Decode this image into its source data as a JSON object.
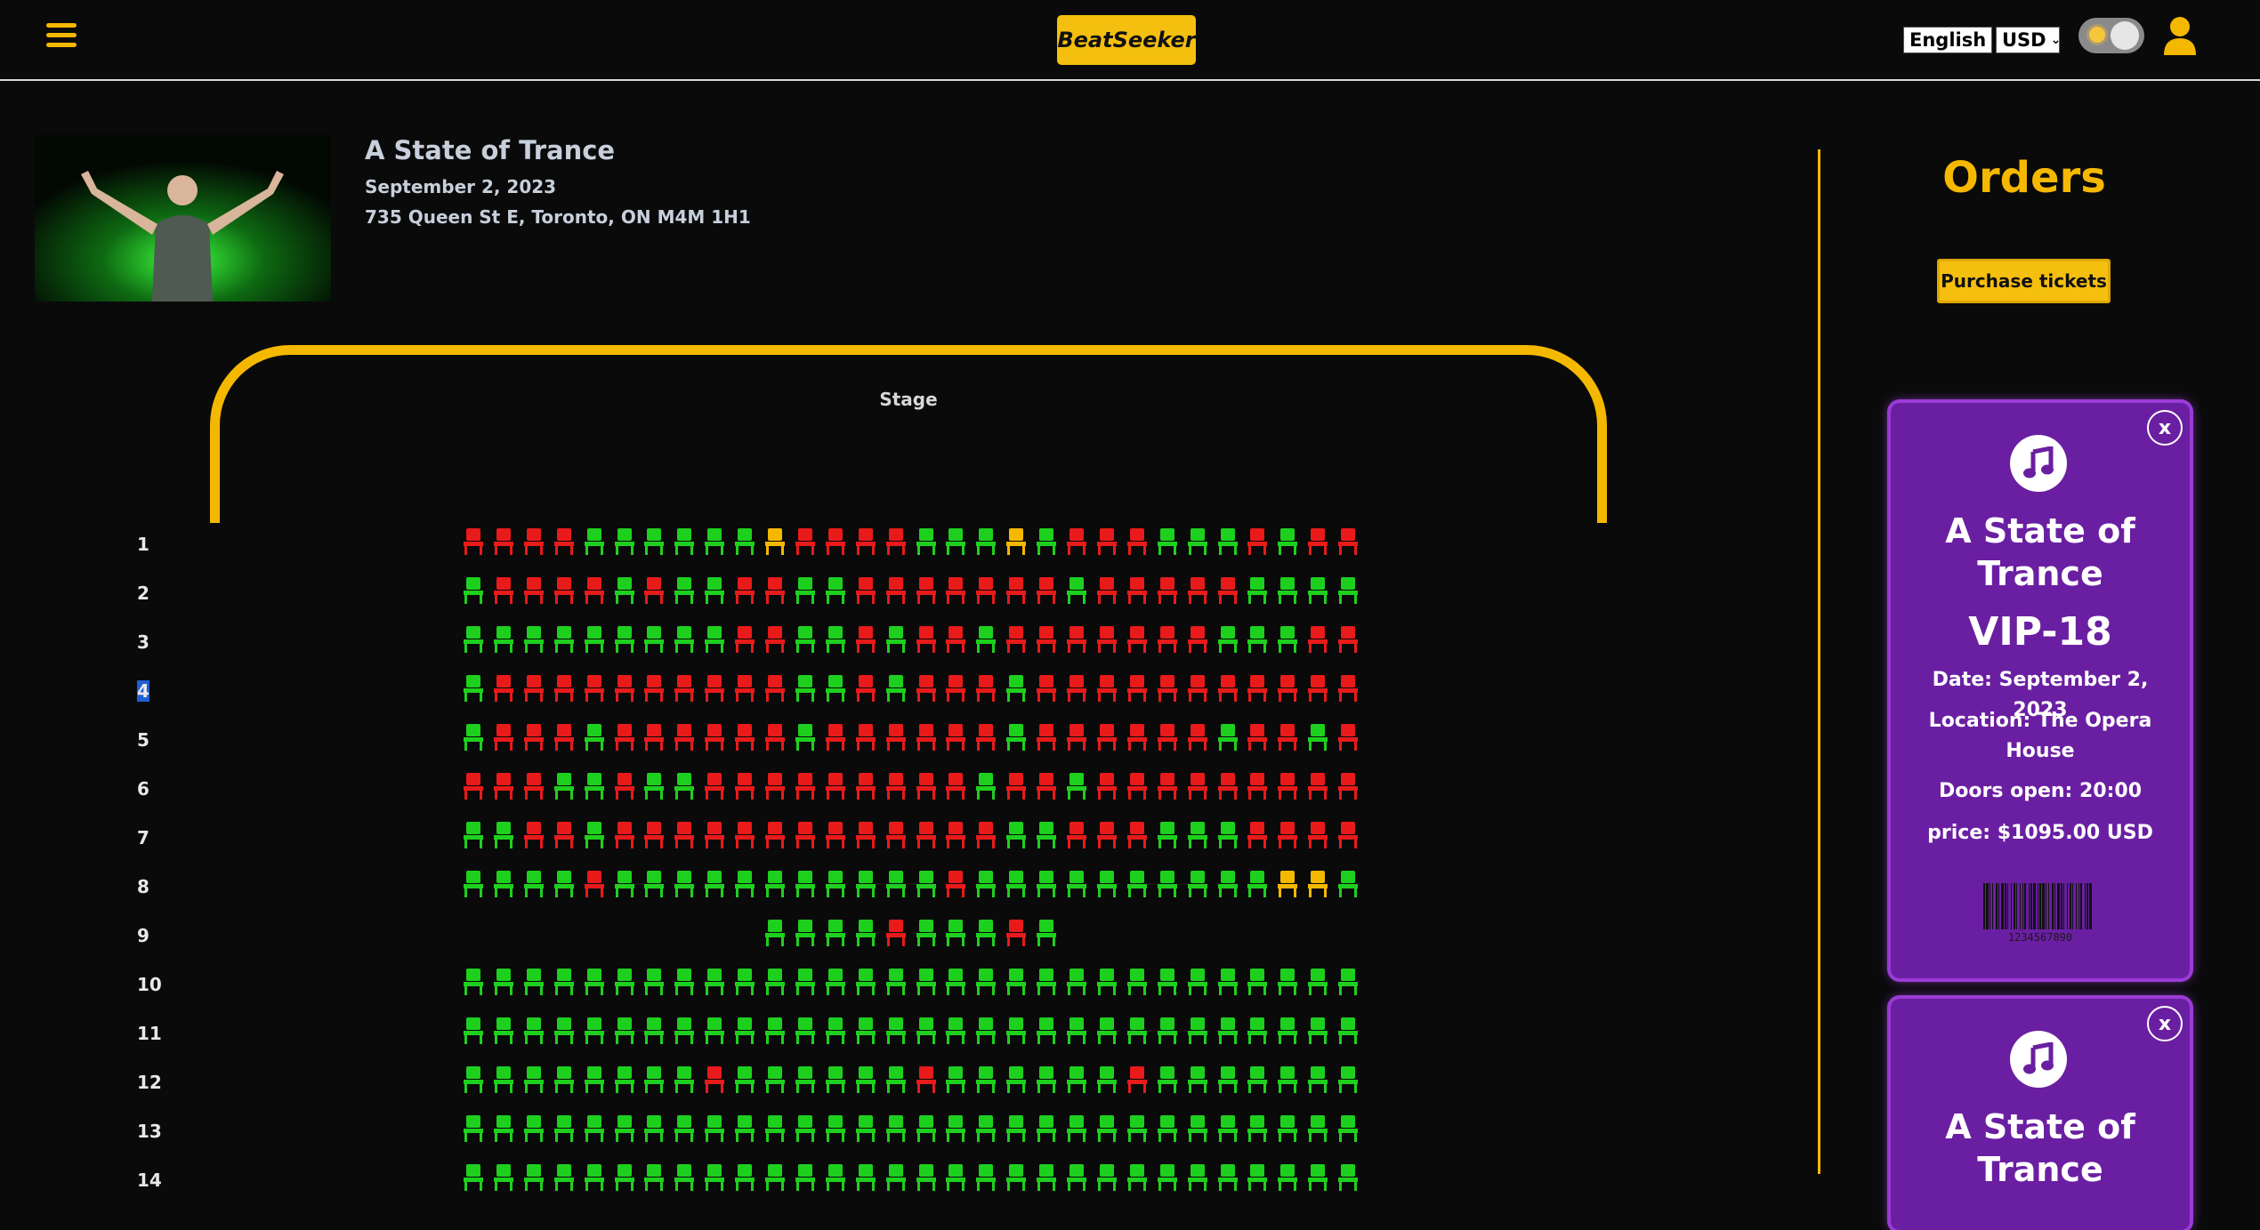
{
  "header": {
    "logo": "BeatSeeker",
    "language": "English",
    "currency": "USD"
  },
  "event": {
    "title": "A State of Trance",
    "date": "September 2, 2023",
    "address": "735 Queen St E, Toronto, ON M4M 1H1"
  },
  "stage": {
    "label": "Stage"
  },
  "seat_colors": {
    "available": "#1ed01e",
    "taken": "#e81a1a",
    "selected": "#f5b800"
  },
  "seating": {
    "rows": [
      {
        "label": "1",
        "seats": "TTTTAAAAAAXTTTTAAAXATTTAAATATTA"
      },
      {
        "label": "2",
        "seats": "ATTTTATAATTAATTTTTTTATTTTTAAAAA"
      },
      {
        "label": "3",
        "seats": "AAAAAAAAATTAATATTATTTTTTTAAATTT"
      },
      {
        "label": "4",
        "seats": "ATTTTTTTTTTAATATTTATTTTTTTTTTT"
      },
      {
        "label": "5",
        "seats": "ATTTATTTTTTATTTTTTATTTTTTATTATTT"
      },
      {
        "label": "6",
        "seats": "TTTAATAATTTTTTTTTATTATTTTTTTTTT"
      },
      {
        "label": "7",
        "seats": "AATTATTTTTTTTTTTTTAATTTAAATTTTAA"
      },
      {
        "label": "8",
        "seats": "AAAATAAAAAAAAAAATAAAAAAAAAAXXAAA"
      },
      {
        "label": "9",
        "seats": "AAAATAAATA",
        "offset": 10
      },
      {
        "label": "10",
        "seats": "AAAAAAAAAAAAAAAAAAAAAAAAAAAAAA"
      },
      {
        "label": "11",
        "seats": "AAAAAAAAAAAAAAAAAAAAAAAAAAAAAA"
      },
      {
        "label": "12",
        "seats": "AAAAAAAATAAAAAATAAAAAATAAAAAAAA"
      },
      {
        "label": "13",
        "seats": "AAAAAAAAAAAAAAAAAAAAAAAAAAAAAA"
      },
      {
        "label": "14",
        "seats": "AAAAAAAAAAAAAAAAAAAAAAAAAAAAAA"
      }
    ]
  },
  "orders": {
    "title": "Orders",
    "purchase_label": "Purchase tickets",
    "tickets": [
      {
        "close": "x",
        "name": "A State of Trance",
        "seat": "VIP-18",
        "date": "Date: September 2, 2023",
        "location": "Location: The Opera House",
        "doors": "Doors open: 20:00",
        "price": "price: $1095.00 USD",
        "barcode_number": "1234567890"
      },
      {
        "close": "x",
        "name": "A State of Trance"
      }
    ]
  }
}
